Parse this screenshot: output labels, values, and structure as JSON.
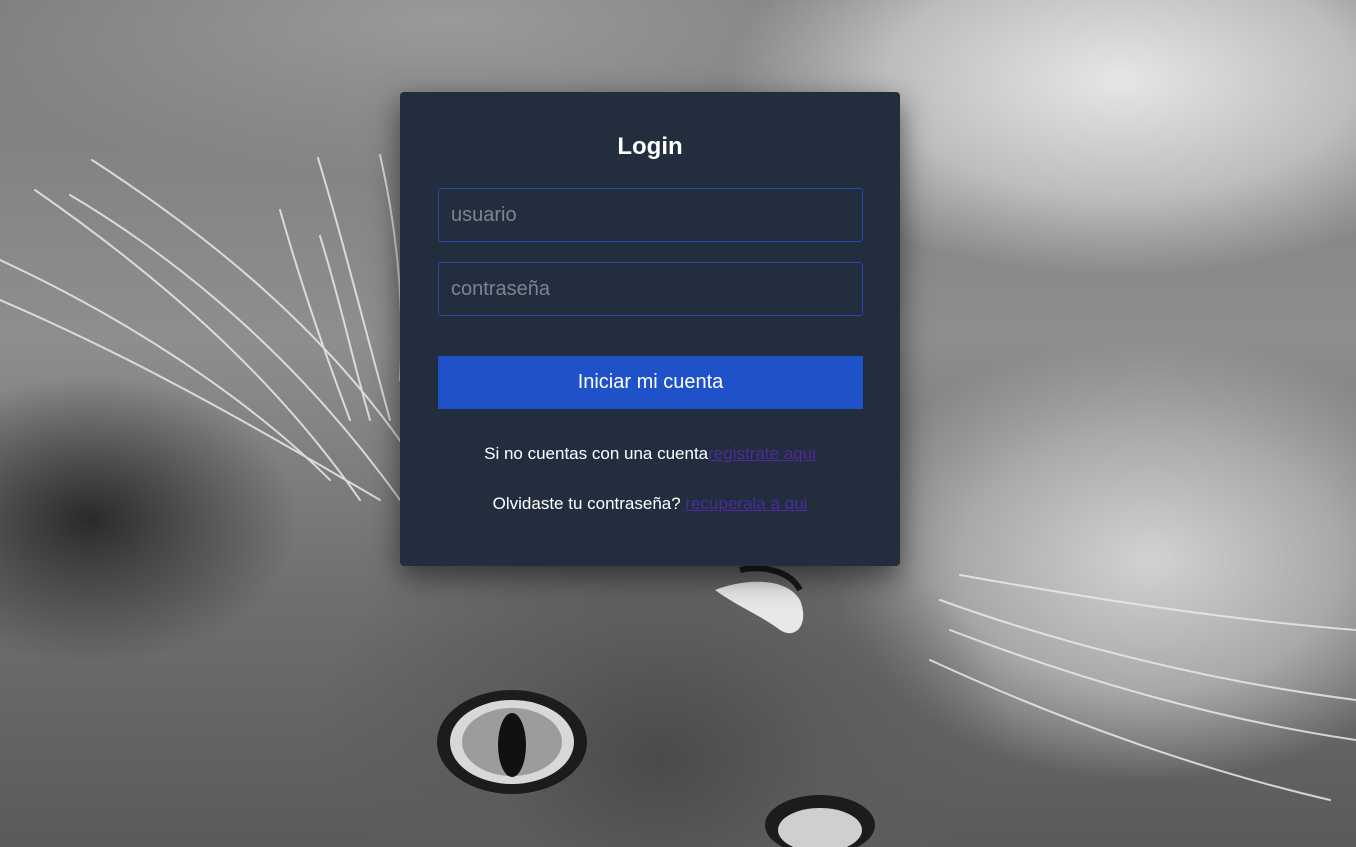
{
  "login": {
    "title": "Login",
    "username_placeholder": "usuario",
    "username_value": "",
    "password_placeholder": "contraseña",
    "password_value": "",
    "submit_label": "Iniciar mi cuenta",
    "register_prompt": "Si no cuentas con una cuenta",
    "register_link": "registrate aqui",
    "recover_prompt": "Olvidaste tu contraseña? ",
    "recover_link": "recuperala a qui"
  },
  "colors": {
    "card_background": "#222e3e",
    "field_border": "#2748a8",
    "button_background": "#1f52c9",
    "link": "#4b2a9a"
  }
}
